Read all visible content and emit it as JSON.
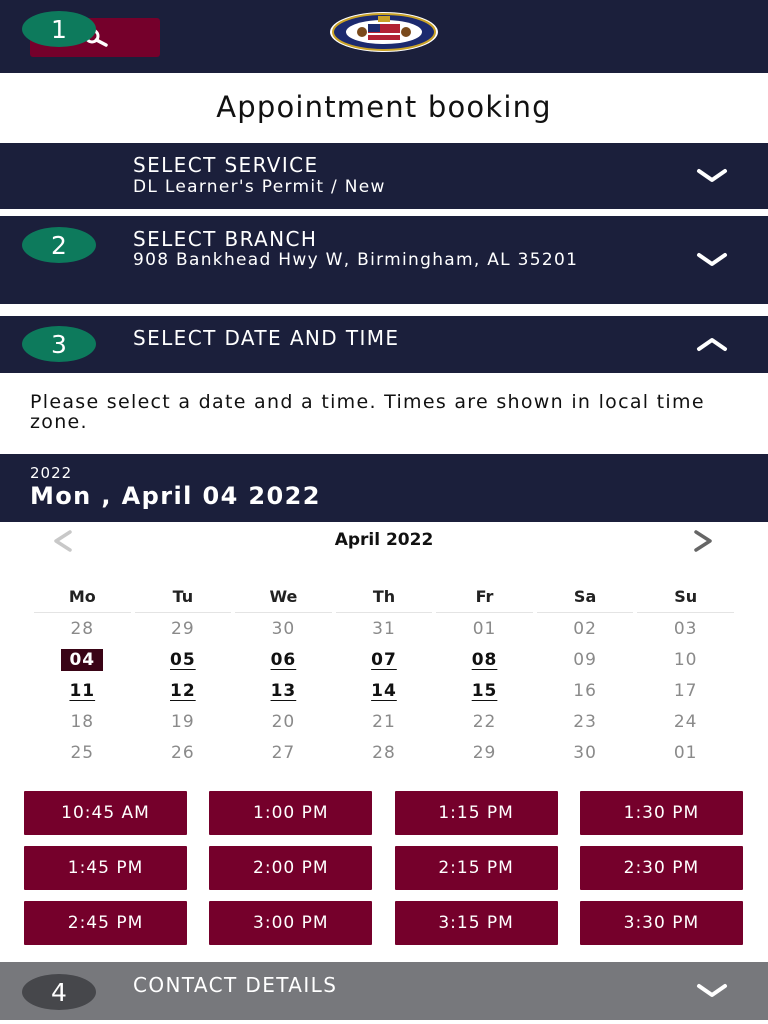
{
  "header": {
    "search_icon": "search-icon",
    "logo": "state-seal-logo"
  },
  "page": {
    "title": "Appointment booking"
  },
  "steps": [
    {
      "number": "1",
      "title": "SELECT SERVICE",
      "subtitle": "DL Learner's Permit / New",
      "state": "collapsed"
    },
    {
      "number": "2",
      "title": "SELECT BRANCH",
      "subtitle": "908 Bankhead Hwy W, Birmingham, AL 35201",
      "state": "collapsed"
    },
    {
      "number": "3",
      "title": "SELECT DATE AND TIME",
      "subtitle": "",
      "state": "expanded"
    },
    {
      "number": "4",
      "title": "CONTACT DETAILS",
      "subtitle": "",
      "state": "disabled"
    }
  ],
  "date_time": {
    "instructions": "Please select a date and a time. Times are shown in local time zone.",
    "selected_year": "2022",
    "selected_date": "Mon , April 04 2022",
    "calendar": {
      "month_label": "April 2022",
      "prev_icon": "chevron-left-icon",
      "next_icon": "chevron-right-icon",
      "weekdays": [
        "Mo",
        "Tu",
        "We",
        "Th",
        "Fr",
        "Sa",
        "Su"
      ],
      "weeks": [
        [
          {
            "d": "28",
            "s": "muted"
          },
          {
            "d": "29",
            "s": "muted"
          },
          {
            "d": "30",
            "s": "muted"
          },
          {
            "d": "31",
            "s": "muted"
          },
          {
            "d": "01",
            "s": "muted"
          },
          {
            "d": "02",
            "s": "muted"
          },
          {
            "d": "03",
            "s": "muted"
          }
        ],
        [
          {
            "d": "04",
            "s": "selected"
          },
          {
            "d": "05",
            "s": "avail"
          },
          {
            "d": "06",
            "s": "avail"
          },
          {
            "d": "07",
            "s": "avail"
          },
          {
            "d": "08",
            "s": "avail"
          },
          {
            "d": "09",
            "s": "muted"
          },
          {
            "d": "10",
            "s": "muted"
          }
        ],
        [
          {
            "d": "11",
            "s": "avail"
          },
          {
            "d": "12",
            "s": "avail"
          },
          {
            "d": "13",
            "s": "avail"
          },
          {
            "d": "14",
            "s": "avail"
          },
          {
            "d": "15",
            "s": "avail"
          },
          {
            "d": "16",
            "s": "muted"
          },
          {
            "d": "17",
            "s": "muted"
          }
        ],
        [
          {
            "d": "18",
            "s": "muted"
          },
          {
            "d": "19",
            "s": "muted"
          },
          {
            "d": "20",
            "s": "muted"
          },
          {
            "d": "21",
            "s": "muted"
          },
          {
            "d": "22",
            "s": "muted"
          },
          {
            "d": "23",
            "s": "muted"
          },
          {
            "d": "24",
            "s": "muted"
          }
        ],
        [
          {
            "d": "25",
            "s": "muted"
          },
          {
            "d": "26",
            "s": "muted"
          },
          {
            "d": "27",
            "s": "muted"
          },
          {
            "d": "28",
            "s": "muted"
          },
          {
            "d": "29",
            "s": "muted"
          },
          {
            "d": "30",
            "s": "muted"
          },
          {
            "d": "01",
            "s": "muted"
          }
        ]
      ]
    },
    "time_slots": [
      "10:45 AM",
      "1:00 PM",
      "1:15 PM",
      "1:30 PM",
      "1:45 PM",
      "2:00 PM",
      "2:15 PM",
      "2:30 PM",
      "2:45 PM",
      "3:00 PM",
      "3:15 PM",
      "3:30 PM"
    ]
  },
  "colors": {
    "navy": "#1b1f3b",
    "maroon": "#75002b",
    "selected_day": "#3a0416",
    "step_badge": "#0d7a5c",
    "disabled_step": "#77787c"
  }
}
